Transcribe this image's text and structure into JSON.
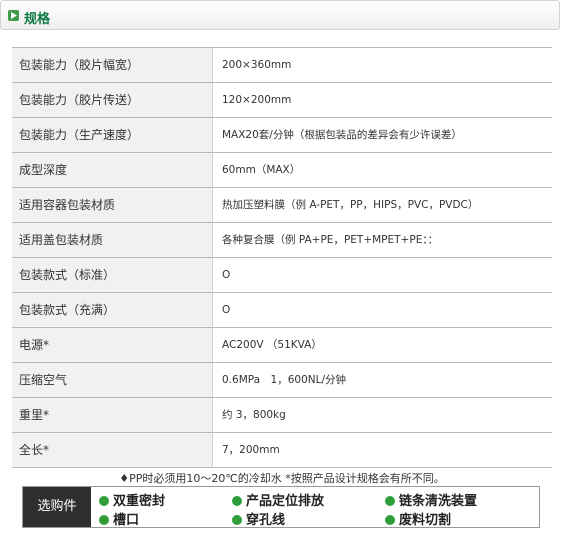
{
  "header": {
    "title": "规格",
    "icon": "play-icon",
    "accent": "#0d7a45"
  },
  "specs": [
    {
      "label": "包装能力（胶片幅宽）",
      "value": "200×360mm"
    },
    {
      "label": "包装能力（胶片传送）",
      "value": "120×200mm"
    },
    {
      "label": "包装能力（生产速度）",
      "value": "MAX20套/分钟（根据包装品的差异会有少许误差）"
    },
    {
      "label": "成型深度",
      "value": "60mm（MAX）"
    },
    {
      "label": "适用容器包装材质",
      "value": "热加压塑料膜（例 A-PET，PP，HIPS，PVC，PVDC）"
    },
    {
      "label": "适用盖包装材质",
      "value": "各种复合膜（例 PA+PE，PET+MPET+PE：："
    },
    {
      "label": "包装款式（标准）",
      "value": "O"
    },
    {
      "label": "包装款式（充满）",
      "value": "O"
    },
    {
      "label": "电源*",
      "value": "AC200V （51KVA）"
    },
    {
      "label": "压缩空气",
      "value": "0.6MPa　1，600NL/分钟"
    },
    {
      "label": "重里*",
      "value": "约 3，800kg"
    },
    {
      "label": "全长*",
      "value": "7，200mm"
    }
  ],
  "note": "♦PP时必须用10～20℃的冷却水 *按照产品设计规格会有所不同。",
  "options": {
    "label": "选购件",
    "bullet_color": "#2e9e3a",
    "items": [
      "双重密封",
      "产品定位排放",
      "链条清洗装置",
      "槽口",
      "穿孔线",
      "废料切割"
    ]
  }
}
